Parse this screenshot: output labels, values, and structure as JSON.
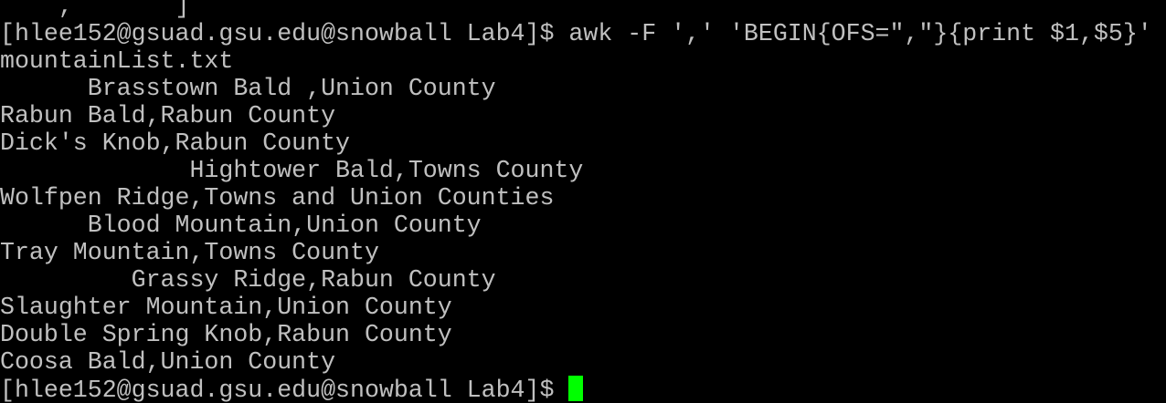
{
  "terminal": {
    "partial_top_line": "    ,       ]",
    "lines": [
      "[hlee152@gsuad.gsu.edu@snowball Lab4]$ awk -F ',' 'BEGIN{OFS=\",\"}{print $1,$5}'",
      "mountainList.txt",
      "      Brasstown Bald ,Union County",
      "Rabun Bald,Rabun County",
      "Dick's Knob,Rabun County",
      "             Hightower Bald,Towns County",
      "Wolfpen Ridge,Towns and Union Counties",
      "      Blood Mountain,Union County",
      "Tray Mountain,Towns County",
      "         Grassy Ridge,Rabun County",
      "Slaughter Mountain,Union County",
      "Double Spring Knob,Rabun County",
      "Coosa Bald,Union County"
    ],
    "prompt": "[hlee152@gsuad.gsu.edu@snowball Lab4]$ ",
    "cursor_color": "#00ff00",
    "text_color": "#c0c0c0",
    "background_color": "#000000"
  }
}
